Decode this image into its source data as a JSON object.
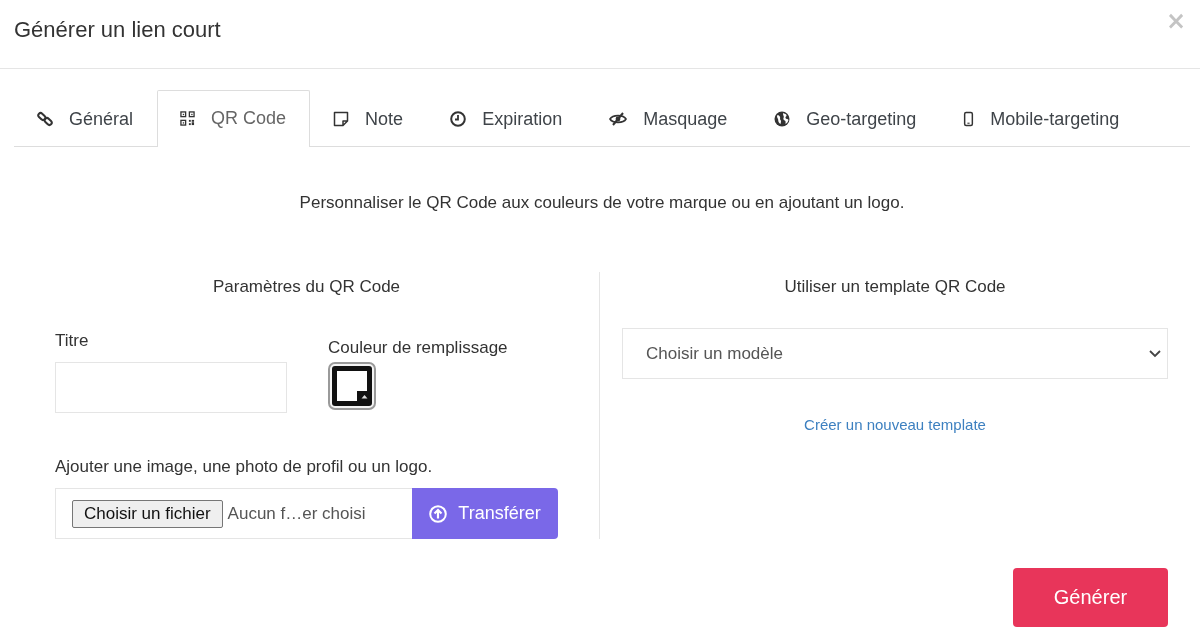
{
  "dialog": {
    "title": "Générer un lien court",
    "close": "×"
  },
  "tabs": [
    {
      "label": "Général",
      "selected": false
    },
    {
      "label": "QR Code",
      "selected": true
    },
    {
      "label": "Note",
      "selected": false
    },
    {
      "label": "Expiration",
      "selected": false
    },
    {
      "label": "Masquage",
      "selected": false
    },
    {
      "label": "Geo-targeting",
      "selected": false
    },
    {
      "label": "Mobile-targeting",
      "selected": false
    }
  ],
  "description": "Personnaliser le QR Code aux couleurs de votre marque ou en ajoutant un logo.",
  "qr_settings": {
    "heading": "Paramètres du QR Code",
    "title_field": {
      "label": "Titre"
    },
    "fill_color": {
      "label": "Couleur de remplissage"
    },
    "upload": {
      "label": "Ajouter une image, une photo de profil ou un logo.",
      "choose_button": "Choisir un fichier",
      "file_status": "Aucun f…er choisi",
      "submit_button": "Transférer"
    }
  },
  "template": {
    "heading": "Utiliser un template QR Code",
    "select": {
      "value": "Choisir un modèle"
    },
    "link": "Créer un nouveau template"
  },
  "footer": {
    "submit_button": "Générer"
  }
}
